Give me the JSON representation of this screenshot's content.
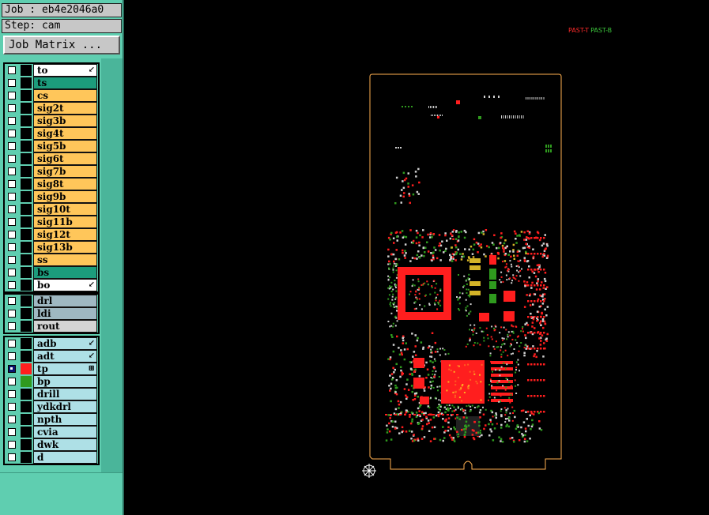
{
  "job_label": "Job : eb4e2046a0",
  "step_label": "Step: cam",
  "job_matrix_label": "Job Matrix ...",
  "board_layers": [
    {
      "name": "to",
      "color": "#ffffff",
      "mark": "↙"
    },
    {
      "name": "ts",
      "color": "#1c9c7c"
    },
    {
      "name": "cs",
      "color": "#ffc65a"
    },
    {
      "name": "sig2t",
      "color": "#ffc65a"
    },
    {
      "name": "sig3b",
      "color": "#ffc65a"
    },
    {
      "name": "sig4t",
      "color": "#ffc65a"
    },
    {
      "name": "sig5b",
      "color": "#ffc65a"
    },
    {
      "name": "sig6t",
      "color": "#ffc65a"
    },
    {
      "name": "sig7b",
      "color": "#ffc65a"
    },
    {
      "name": "sig8t",
      "color": "#ffc65a"
    },
    {
      "name": "sig9b",
      "color": "#ffc65a"
    },
    {
      "name": "sig10t",
      "color": "#ffc65a"
    },
    {
      "name": "sig11b",
      "color": "#ffc65a"
    },
    {
      "name": "sig12t",
      "color": "#ffc65a"
    },
    {
      "name": "sig13b",
      "color": "#ffc65a"
    },
    {
      "name": "ss",
      "color": "#ffc65a"
    },
    {
      "name": "bs",
      "color": "#1c9c7c"
    },
    {
      "name": "bo",
      "color": "#ffffff",
      "mark": "↙"
    }
  ],
  "drill_layers": [
    {
      "name": "drl",
      "color": "#9fb8c2"
    },
    {
      "name": "ldi",
      "color": "#9fb8c2"
    },
    {
      "name": "rout",
      "color": "#d4d4d4"
    }
  ],
  "misc_layers": [
    {
      "name": "adb",
      "color": "#aee0e6",
      "mark": "↙"
    },
    {
      "name": "adt",
      "color": "#aee0e6",
      "mark": "↙"
    },
    {
      "name": "tp",
      "color": "#aee0e6",
      "mark": "⊞",
      "checked": true,
      "swatch": "#ff1e1e"
    },
    {
      "name": "bp",
      "color": "#aee0e6",
      "swatch": "#2f9a1e"
    },
    {
      "name": "drill",
      "color": "#aee0e6"
    },
    {
      "name": "ydkdrl",
      "color": "#aee0e6"
    },
    {
      "name": "npth",
      "color": "#aee0e6"
    },
    {
      "name": "cvia",
      "color": "#aee0e6"
    },
    {
      "name": "dwk",
      "color": "#aee0e6"
    },
    {
      "name": "d",
      "color": "#aee0e6"
    }
  ],
  "legend": {
    "top": "PAST-T",
    "bottom": "PAST-B",
    "top_color": "#ff2a2a",
    "bottom_color": "#3cc43c"
  },
  "colors": {
    "outline": "#ffb050",
    "paste_top": "#ff1e1e",
    "paste_bottom": "#2f9a1e",
    "pad_yellow": "#d4b428"
  }
}
